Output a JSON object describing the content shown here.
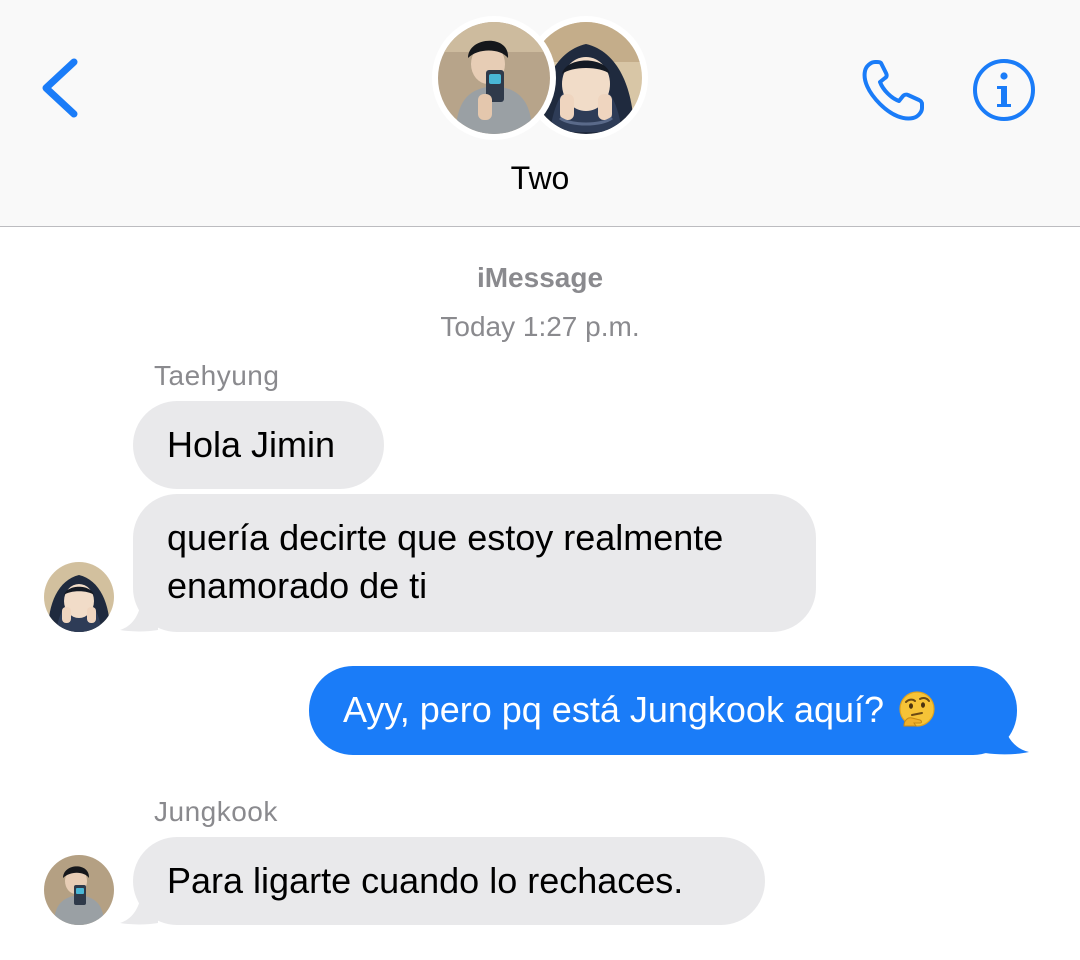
{
  "header": {
    "title": "Two",
    "back_icon": "chevron-left-icon",
    "call_icon": "phone-icon",
    "info_icon": "info-icon",
    "accent_color": "#1a7cf8"
  },
  "thread": {
    "service": "iMessage",
    "timestamp": "Today 1:27 p.m."
  },
  "messages": {
    "sender_taehyung": "Taehyung",
    "msg1": "Hola Jimin",
    "msg2_line1": "quería decirte que estoy realmente",
    "msg2_line2": "enamorado de ti",
    "msg3": "Ayy, pero pq está Jungkook aquí?",
    "msg3_emoji": "thinking-face-emoji",
    "sender_jungkook": "Jungkook",
    "msg4": "Para ligarte cuando lo rechaces."
  },
  "colors": {
    "incoming_bubble": "#e9e9eb",
    "outgoing_bubble": "#1a7cf8",
    "meta_text": "#8a8a8e",
    "header_bg": "#f9f9f9"
  }
}
